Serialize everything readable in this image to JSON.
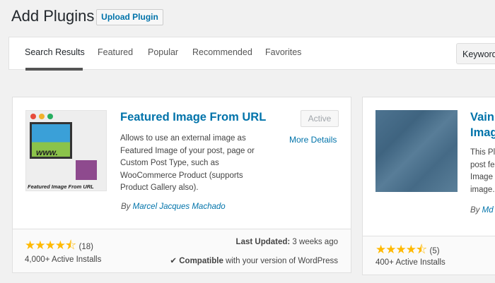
{
  "header": {
    "title": "Add Plugins",
    "upload_label": "Upload Plugin"
  },
  "tabs": [
    "Search Results",
    "Featured",
    "Popular",
    "Recommended",
    "Favorites"
  ],
  "search": {
    "type_label": "Keyword"
  },
  "plugins": [
    {
      "name": "Featured Image From URL",
      "thumb_caption": "Featured Image From URL",
      "thumb_www": "www.",
      "action": "Active",
      "more": "More Details",
      "description": "Allows to use an external image as Featured Image of your post, page or Custom Post Type, such as WooCommerce Product (supports Product Gallery also).",
      "by": "By",
      "author": "Marcel Jacques Machado",
      "rating": 4.5,
      "stars": "★★★★⯪",
      "count": "(18)",
      "installs": "4,000+ Active Installs",
      "updated_label": "Last Updated:",
      "updated": "3 weeks ago",
      "compat_icon": "✔",
      "compat_bold": "Compatible",
      "compat_rest": "with your version of WordPress"
    },
    {
      "name_l1": "Vain",
      "name_l2": "Imag",
      "desc_lines": [
        "This Pl",
        "post fe",
        "Image",
        "image."
      ],
      "by": "By",
      "author": "Md",
      "rating": 4.5,
      "stars": "★★★★⯪",
      "count": "(5)",
      "installs": "400+ Active Installs"
    }
  ]
}
